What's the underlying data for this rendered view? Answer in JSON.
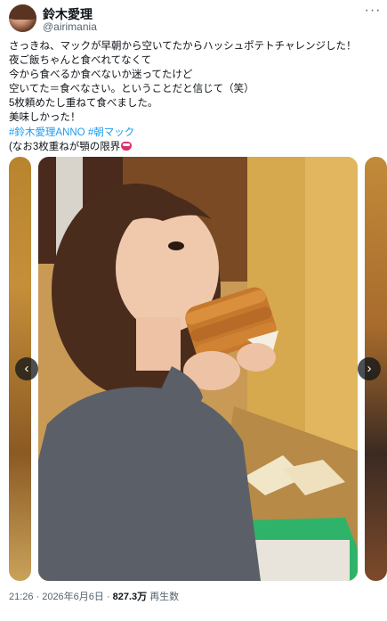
{
  "author": {
    "name": "鈴木愛理",
    "handle": "@airimania"
  },
  "more_icon": "more-horizontal-icon",
  "tweet": {
    "lines": [
      "さっきね、マックが早朝から空いてたからハッシュポテトチャレンジした！",
      "夜ご飯ちゃんと食べれてなくて",
      "今から食べるか食べないか迷ってたけど",
      "空いてた＝食べなさい。ということだと信じて（笑）",
      "5枚頼めたし重ねて食べました。",
      "美味しかった！"
    ],
    "hashtag1": "#鈴木愛理ANNO",
    "hashtag2": "#朝マック",
    "last_line": "(なお3枚重ねが顎の限界",
    "emoji": "mouth-emoji"
  },
  "carousel": {
    "prev_label": "‹",
    "next_label": "›",
    "photo_subject": "woman eating stacked hash browns"
  },
  "meta": {
    "time": "21:26",
    "date": "2026年6月6日",
    "views": "827.3万",
    "views_label": "再生数"
  },
  "colors": {
    "link": "#1d9bf0",
    "text": "#0f1419",
    "secondary": "#536471"
  }
}
